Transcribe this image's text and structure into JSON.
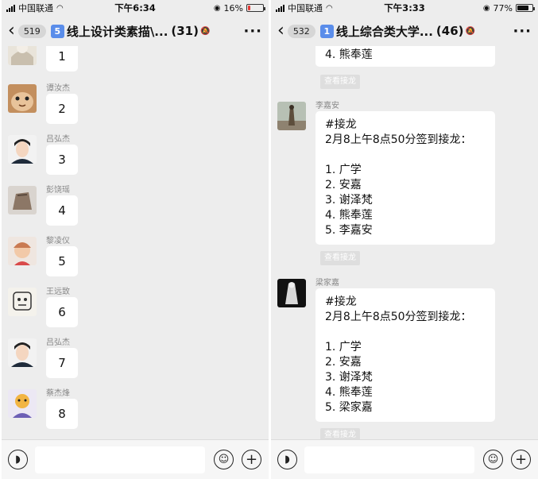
{
  "left_phone": {
    "status": {
      "carrier": "中国联通",
      "time": "下午6:34",
      "battery": "16%",
      "battery_level": 0.16,
      "battery_color": "#e53935"
    },
    "nav": {
      "back_count": "519",
      "badge": "5",
      "title": "线上设计类素描\\...",
      "member_count": "(31)"
    },
    "messages": [
      {
        "sender": "",
        "text": "1"
      },
      {
        "sender": "谭汝杰",
        "text": "2"
      },
      {
        "sender": "吕弘杰",
        "text": "3"
      },
      {
        "sender": "彭饶瑶",
        "text": "4"
      },
      {
        "sender": "黎凌仪",
        "text": "5"
      },
      {
        "sender": "王远致",
        "text": "6"
      },
      {
        "sender": "吕弘杰",
        "text": "7"
      },
      {
        "sender": "蔡杰烽",
        "text": "8"
      }
    ]
  },
  "right_phone": {
    "status": {
      "carrier": "中国联通",
      "time": "下午3:33",
      "battery": "77%",
      "battery_level": 0.77,
      "battery_color": "#111111"
    },
    "nav": {
      "back_count": "532",
      "badge": "1",
      "title": "线上综合类大学...",
      "member_count": "(46)"
    },
    "top_partial_line": "4. 熊奉莲",
    "view_link_label": "查看接龙",
    "messages": [
      {
        "sender": "李嘉安",
        "lines": [
          "#接龙",
          "2月8上午8点50分签到接龙：",
          "",
          "1. 广学",
          "2. 安嘉",
          "3. 谢泽梵",
          "4. 熊奉莲",
          "5. 李嘉安"
        ]
      },
      {
        "sender": "梁家嘉",
        "lines": [
          "#接龙",
          "2月8上午8点50分签到接龙：",
          "",
          "1. 广学",
          "2. 安嘉",
          "3. 谢泽梵",
          "4. 熊奉莲",
          "5. 梁家嘉"
        ]
      }
    ]
  },
  "icons": {
    "back": "chevron-left-icon",
    "more": "more-icon",
    "voice": "voice-icon",
    "emoji": "emoji-icon",
    "plus": "plus-icon",
    "wifi": "wifi-icon",
    "mute": "mute-icon",
    "alarm": "alarm-icon"
  }
}
